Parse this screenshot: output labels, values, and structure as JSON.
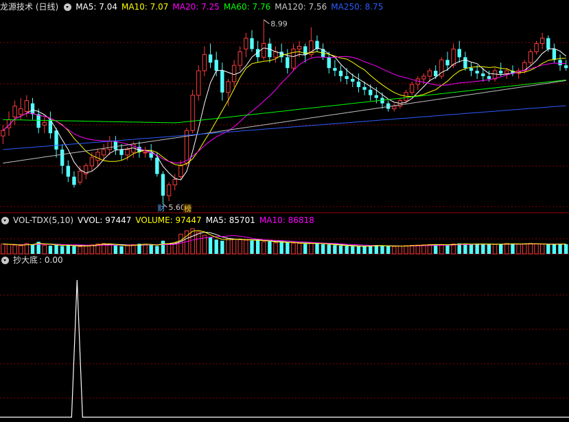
{
  "main_header": {
    "title": "龙源技术 (日线)",
    "ma5_label": "MA5: 7.04",
    "ma10_label": "MA10: 7.07",
    "ma20_label": "MA20: 7.25",
    "ma60_label": "MA60: 7.76",
    "ma120_label": "MA120: 7.56",
    "ma250_label": "MA250: 8.75"
  },
  "vol_header": {
    "title": "VOL-TDX(5,10)",
    "vvol_label": "VVOL: 97447",
    "volume_label": "VOLUME: 97447",
    "ma5_label": "MA5: 85701",
    "ma10_label": "MA10: 86818"
  },
  "ind_header": {
    "title": "抄大底",
    "value_label": ": 0.00"
  },
  "colors": {
    "up": "#ff3c3c",
    "down": "#54ffff",
    "ma5": "#ffffff",
    "ma10": "#ffff00",
    "ma20": "#ff00ff",
    "ma60": "#00ff00",
    "ma120": "#c0c0c0",
    "ma250": "#2d5bff",
    "grid": "#8c0000"
  },
  "chart_data": [
    {
      "type": "candlestick",
      "panel": "price",
      "high_annotation": "8.99",
      "low_annotation": "5.60",
      "markers": [
        "财",
        "榜"
      ],
      "ylim": [
        5.5,
        9.1
      ],
      "ohlc": [
        [
          6.85,
          7.05,
          6.7,
          6.95
        ],
        [
          7.0,
          7.3,
          6.85,
          7.15
        ],
        [
          7.2,
          7.5,
          7.05,
          7.4
        ],
        [
          7.25,
          7.55,
          7.15,
          7.35
        ],
        [
          7.3,
          7.6,
          7.2,
          7.5
        ],
        [
          7.45,
          7.55,
          7.15,
          7.25
        ],
        [
          7.25,
          7.35,
          6.9,
          7.0
        ],
        [
          7.05,
          7.2,
          6.9,
          7.1
        ],
        [
          7.15,
          7.3,
          6.8,
          6.9
        ],
        [
          6.95,
          7.0,
          6.45,
          6.6
        ],
        [
          6.6,
          6.7,
          6.15,
          6.3
        ],
        [
          6.3,
          6.4,
          6.0,
          6.1
        ],
        [
          6.1,
          6.2,
          5.9,
          5.95
        ],
        [
          6.0,
          6.3,
          5.95,
          6.2
        ],
        [
          6.15,
          6.35,
          6.05,
          6.3
        ],
        [
          6.3,
          6.55,
          6.2,
          6.45
        ],
        [
          6.4,
          6.6,
          6.3,
          6.55
        ],
        [
          6.5,
          6.7,
          6.4,
          6.6
        ],
        [
          6.6,
          6.85,
          6.5,
          6.75
        ],
        [
          6.75,
          6.85,
          6.5,
          6.6
        ],
        [
          6.6,
          6.7,
          6.4,
          6.5
        ],
        [
          6.5,
          6.65,
          6.4,
          6.6
        ],
        [
          6.55,
          6.75,
          6.45,
          6.7
        ],
        [
          6.65,
          6.75,
          6.45,
          6.55
        ],
        [
          6.55,
          6.65,
          6.45,
          6.55
        ],
        [
          6.55,
          6.7,
          6.4,
          6.45
        ],
        [
          6.45,
          6.55,
          6.1,
          6.15
        ],
        [
          6.15,
          6.2,
          5.6,
          5.75
        ],
        [
          5.75,
          6.0,
          5.65,
          5.95
        ],
        [
          5.95,
          6.15,
          5.85,
          6.05
        ],
        [
          6.1,
          6.4,
          6.05,
          6.3
        ],
        [
          6.35,
          7.0,
          6.3,
          6.95
        ],
        [
          6.95,
          7.7,
          6.9,
          7.6
        ],
        [
          7.6,
          8.15,
          7.5,
          8.05
        ],
        [
          8.05,
          8.5,
          7.95,
          8.35
        ],
        [
          8.35,
          8.55,
          8.1,
          8.2
        ],
        [
          8.25,
          8.4,
          7.95,
          8.05
        ],
        [
          8.05,
          8.2,
          7.5,
          7.65
        ],
        [
          7.65,
          7.9,
          7.4,
          7.85
        ],
        [
          7.85,
          8.25,
          7.75,
          8.15
        ],
        [
          8.15,
          8.5,
          8.05,
          8.4
        ],
        [
          8.45,
          8.75,
          8.3,
          8.65
        ],
        [
          8.65,
          8.8,
          8.4,
          8.45
        ],
        [
          8.45,
          8.6,
          8.2,
          8.3
        ],
        [
          8.3,
          8.99,
          8.25,
          8.55
        ],
        [
          8.55,
          8.65,
          8.2,
          8.3
        ],
        [
          8.3,
          8.5,
          8.2,
          8.4
        ],
        [
          8.4,
          8.55,
          8.2,
          8.3
        ],
        [
          8.3,
          8.45,
          8.0,
          8.1
        ],
        [
          8.1,
          8.55,
          8.05,
          8.45
        ],
        [
          8.45,
          8.6,
          8.3,
          8.5
        ],
        [
          8.5,
          8.55,
          8.2,
          8.35
        ],
        [
          8.35,
          8.85,
          8.3,
          8.6
        ],
        [
          8.6,
          8.7,
          8.4,
          8.45
        ],
        [
          8.45,
          8.55,
          8.25,
          8.3
        ],
        [
          8.3,
          8.4,
          8.0,
          8.1
        ],
        [
          8.1,
          8.25,
          7.95,
          8.05
        ],
        [
          8.05,
          8.15,
          7.85,
          7.95
        ],
        [
          7.95,
          8.1,
          7.8,
          7.9
        ],
        [
          7.9,
          8.0,
          7.75,
          7.85
        ],
        [
          7.85,
          8.0,
          7.65,
          7.75
        ],
        [
          7.75,
          7.85,
          7.6,
          7.7
        ],
        [
          7.7,
          7.8,
          7.5,
          7.6
        ],
        [
          7.6,
          7.75,
          7.45,
          7.55
        ],
        [
          7.55,
          7.65,
          7.35,
          7.45
        ],
        [
          7.45,
          7.5,
          7.3,
          7.35
        ],
        [
          7.35,
          7.45,
          7.3,
          7.4
        ],
        [
          7.4,
          7.55,
          7.35,
          7.5
        ],
        [
          7.5,
          7.7,
          7.45,
          7.65
        ],
        [
          7.65,
          7.85,
          7.6,
          7.8
        ],
        [
          7.8,
          7.95,
          7.7,
          7.9
        ],
        [
          7.9,
          8.0,
          7.8,
          7.95
        ],
        [
          7.95,
          8.1,
          7.85,
          8.05
        ],
        [
          8.05,
          8.15,
          7.9,
          7.95
        ],
        [
          7.95,
          8.3,
          7.9,
          8.25
        ],
        [
          8.25,
          8.4,
          8.05,
          8.15
        ],
        [
          8.15,
          8.55,
          8.1,
          8.45
        ],
        [
          8.45,
          8.6,
          8.2,
          8.3
        ],
        [
          8.3,
          8.4,
          8.05,
          8.1
        ],
        [
          8.1,
          8.2,
          7.95,
          8.05
        ],
        [
          8.05,
          8.15,
          7.9,
          8.0
        ],
        [
          8.0,
          8.1,
          7.85,
          7.95
        ],
        [
          7.95,
          8.05,
          7.85,
          7.9
        ],
        [
          7.9,
          8.1,
          7.85,
          8.05
        ],
        [
          8.05,
          8.2,
          7.95,
          8.0
        ],
        [
          8.0,
          8.1,
          7.9,
          8.05
        ],
        [
          8.05,
          8.15,
          7.95,
          8.0
        ],
        [
          8.0,
          8.1,
          7.9,
          8.05
        ],
        [
          8.05,
          8.25,
          8.0,
          8.2
        ],
        [
          8.2,
          8.45,
          8.15,
          8.4
        ],
        [
          8.4,
          8.6,
          8.35,
          8.55
        ],
        [
          8.55,
          8.75,
          8.45,
          8.65
        ],
        [
          8.65,
          8.7,
          8.4,
          8.45
        ],
        [
          8.45,
          8.55,
          8.2,
          8.25
        ],
        [
          8.25,
          8.35,
          8.05,
          8.15
        ],
        [
          8.15,
          8.25,
          8.05,
          8.1
        ]
      ]
    },
    {
      "type": "bar",
      "panel": "volume",
      "values": [
        90,
        85,
        80,
        75,
        95,
        85,
        110,
        80,
        75,
        88,
        72,
        80,
        70,
        65,
        78,
        82,
        90,
        95,
        88,
        80,
        70,
        75,
        85,
        92,
        88,
        80,
        72,
        120,
        90,
        100,
        180,
        210,
        230,
        200,
        170,
        150,
        130,
        120,
        140,
        135,
        130,
        125,
        120,
        130,
        110,
        115,
        100,
        110,
        105,
        98,
        95,
        90,
        100,
        95,
        88,
        85,
        80,
        75,
        72,
        70,
        68,
        70,
        75,
        80,
        72,
        70,
        68,
        72,
        75,
        78,
        80,
        82,
        85,
        88,
        82,
        80,
        90,
        95,
        88,
        85,
        92,
        90,
        88,
        85,
        90,
        95,
        90,
        88,
        92,
        95,
        90,
        88,
        85,
        90,
        92,
        88
      ],
      "ma5": "VVOL: 97447",
      "ylim": [
        0,
        250
      ]
    },
    {
      "type": "line",
      "panel": "indicator",
      "name": "抄大底",
      "spike_index": 13,
      "spike_value": 1,
      "ylim": [
        0,
        1.1
      ]
    }
  ]
}
